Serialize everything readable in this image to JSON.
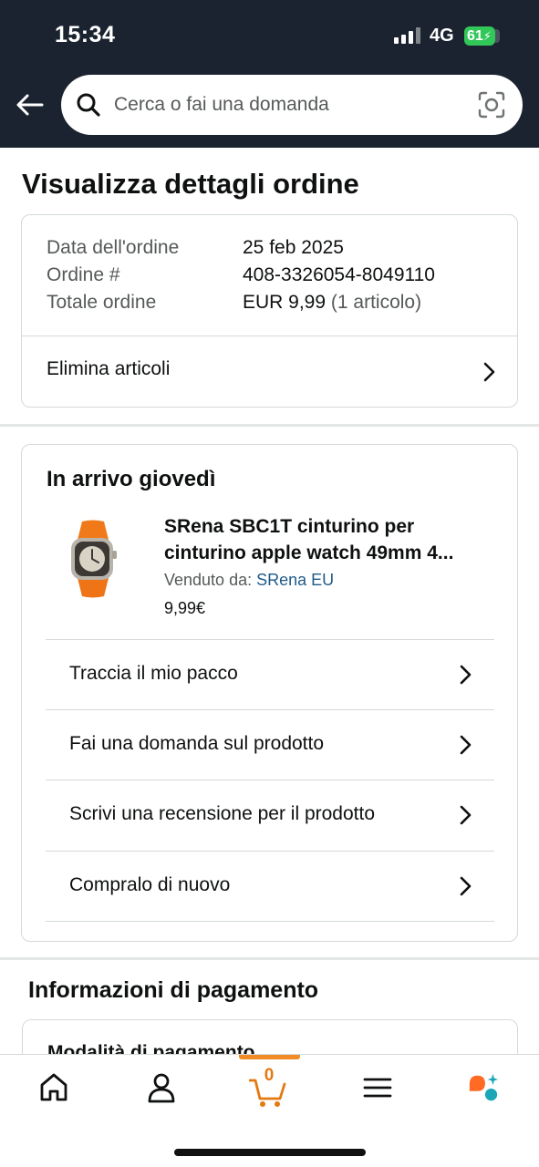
{
  "status_bar": {
    "time": "15:34",
    "network": "4G",
    "battery": "61"
  },
  "search": {
    "placeholder": "Cerca o fai una domanda"
  },
  "page_title": "Visualizza dettagli ordine",
  "order_summary": {
    "rows": [
      {
        "label": "Data dell'ordine",
        "value": "25 feb 2025",
        "extra": ""
      },
      {
        "label": "Ordine #",
        "value": "408-3326054-8049110",
        "extra": ""
      },
      {
        "label": "Totale ordine",
        "value": "EUR 9,99",
        "extra": "(1 articolo)"
      }
    ],
    "action": "Elimina articoli"
  },
  "delivery": {
    "title": "In arrivo giovedì",
    "product": {
      "name_line1": "SRena SBC1T cinturino per",
      "name_line2": "cinturino apple watch 49mm 4...",
      "seller_label": "Venduto da:",
      "seller_name": "SRena EU",
      "price": "9,99€"
    },
    "actions": [
      "Traccia il mio pacco",
      "Fai una domanda sul prodotto",
      "Scrivi una recensione per il prodotto",
      "Compralo di nuovo"
    ]
  },
  "payment": {
    "title": "Informazioni di pagamento",
    "subtitle": "Modalità di pagamento"
  },
  "bottom_nav": {
    "cart_count": "0",
    "icons": [
      "home-icon",
      "account-icon",
      "cart-icon",
      "menu-icon",
      "rufus-assistant-icon"
    ]
  },
  "colors": {
    "header_bg": "#1b2330",
    "link": "#1f5a8a",
    "cart_accent": "#f08b25",
    "battery": "#32c759"
  }
}
